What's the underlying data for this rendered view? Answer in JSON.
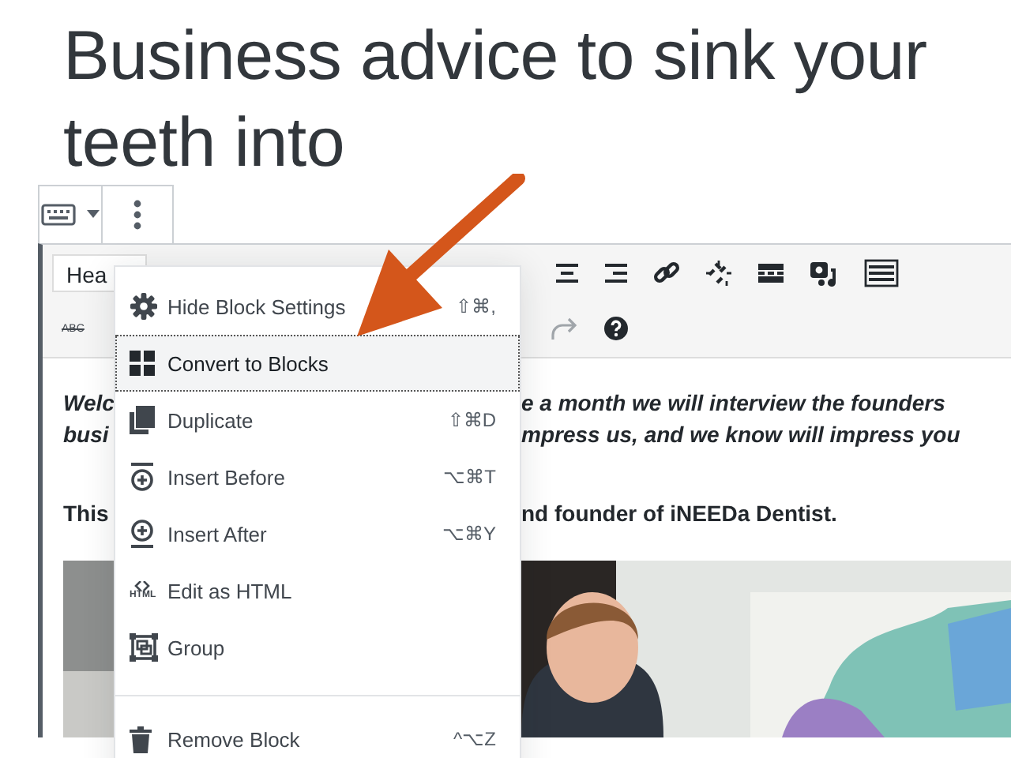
{
  "title": "Business advice to sink your teeth into",
  "classic_toolbar": {
    "format_select": "Hea",
    "strikethrough_label": "ABC"
  },
  "content": {
    "intro_lines": [
      {
        "left": "Welc",
        "right": "e a month we will interview the founders"
      },
      {
        "left": "busi",
        "right": "mpress us, and we know will impress you"
      }
    ],
    "byline": {
      "left": "This",
      "right": "nd founder of iNEEDa Dentist."
    }
  },
  "menu": {
    "items": [
      {
        "kind": "action",
        "label": "Hide Block Settings",
        "shortcut": "⇧⌘,",
        "selected": false
      },
      {
        "kind": "action",
        "label": "Convert to Blocks",
        "selected": true
      },
      {
        "kind": "action",
        "label": "Duplicate",
        "shortcut": "⇧⌘D",
        "selected": false
      },
      {
        "kind": "action",
        "label": "Insert Before",
        "shortcut": "⌥⌘T",
        "selected": false
      },
      {
        "kind": "action",
        "label": "Insert After",
        "shortcut": "⌥⌘Y",
        "selected": false
      },
      {
        "kind": "action",
        "label": "Edit as HTML",
        "icon_label": "HTML",
        "selected": false
      },
      {
        "kind": "action",
        "label": "Group",
        "selected": false
      },
      {
        "kind": "divider"
      },
      {
        "kind": "action",
        "label": "Remove Block",
        "shortcut": "^⌥Z",
        "selected": false
      }
    ]
  }
}
